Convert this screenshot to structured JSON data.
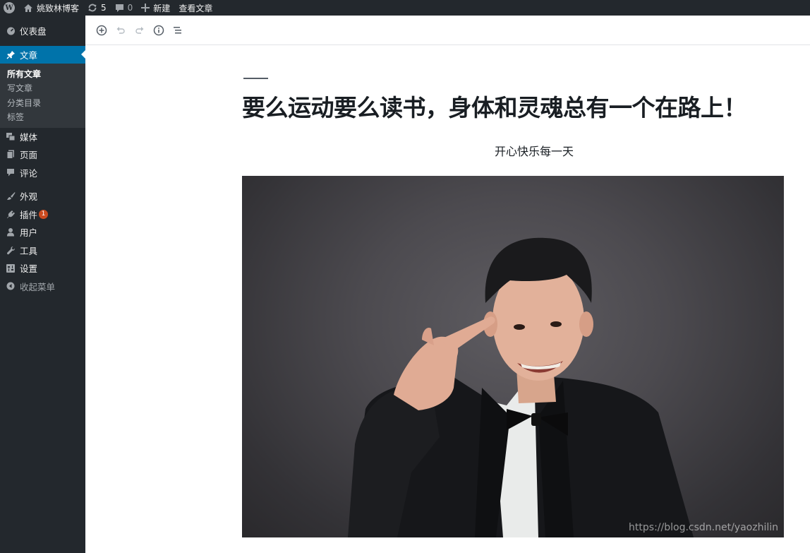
{
  "adminbar": {
    "site_name": "姚致林博客",
    "updates_count": "5",
    "comments_count": "0",
    "new_label": "新建",
    "view_label": "查看文章"
  },
  "sidebar": {
    "dashboard": "仪表盘",
    "posts": "文章",
    "submenu": [
      "所有文章",
      "写文章",
      "分类目录",
      "标签"
    ],
    "media": "媒体",
    "pages": "页面",
    "comments": "评论",
    "appearance": "外观",
    "plugins": "插件",
    "plugins_badge": "1",
    "users": "用户",
    "tools": "工具",
    "settings": "设置",
    "collapse": "收起菜单"
  },
  "editor": {
    "title": "要么运动要么读书，身体和灵魂总有一个在路上！",
    "subtitle": "开心快乐每一天",
    "watermark": "https://blog.csdn.net/yaozhilin"
  },
  "colors": {
    "adminbar_bg": "#23282d",
    "active_menu": "#0073aa",
    "badge": "#ca4a1f"
  }
}
